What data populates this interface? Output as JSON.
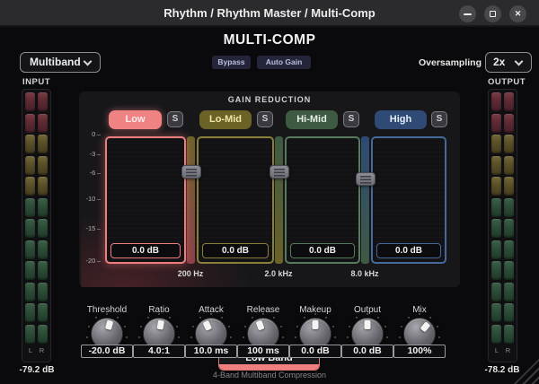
{
  "window": {
    "title": "Rhythm / Rhythm Master / Multi-Comp"
  },
  "header": {
    "title": "MULTI-COMP",
    "mode_value": "Multiband",
    "bypass_label": "Bypass",
    "auto_gain_label": "Auto Gain",
    "oversampling_label": "Oversampling",
    "oversampling_value": "2x"
  },
  "meters": {
    "input": {
      "label": "INPUT",
      "channels": [
        "L",
        "R"
      ],
      "value": "-79.2 dB",
      "segments": {
        "red": 2,
        "yellow": 3,
        "green": 7
      }
    },
    "output": {
      "label": "OUTPUT",
      "channels": [
        "L",
        "R"
      ],
      "value": "-78.2 dB",
      "segments": {
        "red": 2,
        "yellow": 3,
        "green": 7
      }
    },
    "segment_colors": {
      "red": "#5e2a33",
      "yellow": "#5a5028",
      "green": "#2c4d38"
    }
  },
  "gain_reduction": {
    "title": "GAIN REDUCTION",
    "solo_label": "S",
    "scale": [
      "0",
      "-3",
      "-6",
      "-10",
      "-15",
      "-20"
    ],
    "bands": [
      {
        "name": "Low",
        "value": "0.0 dB",
        "selected": true,
        "colors": {
          "tab_bg": "#ef8282",
          "tab_text": "#ffecec",
          "border": "#ee7e7e",
          "track": "#8a4048"
        }
      },
      {
        "name": "Lo-Mid",
        "value": "0.0 dB",
        "selected": false,
        "colors": {
          "tab_bg": "#6b6228",
          "tab_text": "#efe6a8",
          "border": "#8a7f3a",
          "track": "#6b6228"
        }
      },
      {
        "name": "Hi-Mid",
        "value": "0.0 dB",
        "selected": false,
        "colors": {
          "tab_bg": "#3e5a43",
          "tab_text": "#e6efe6",
          "border": "#57795c",
          "track": "#3e5a43"
        }
      },
      {
        "name": "High",
        "value": "0.0 dB",
        "selected": false,
        "colors": {
          "tab_bg": "#2e4a75",
          "tab_text": "#e6ecf8",
          "border": "#46699c",
          "track": "#2e4a75"
        }
      }
    ],
    "crossovers": [
      {
        "freq": "200 Hz"
      },
      {
        "freq": "2.0 kHz"
      },
      {
        "freq": "8.0 kHz"
      }
    ]
  },
  "knobs": [
    {
      "label": "Threshold",
      "value": "-20.0 dB",
      "angle": 15
    },
    {
      "label": "Ratio",
      "value": "4.0:1",
      "angle": 10
    },
    {
      "label": "Attack",
      "value": "10.0 ms",
      "angle": -25
    },
    {
      "label": "Release",
      "value": "100 ms",
      "angle": -20
    },
    {
      "label": "Makeup",
      "value": "0.0 dB",
      "angle": 0
    },
    {
      "label": "Output",
      "value": "0.0 dB",
      "angle": 0
    },
    {
      "label": "Mix",
      "value": "100%",
      "angle": 40
    }
  ],
  "band_indicator": {
    "label": "Low Band",
    "color": "#f08080"
  },
  "footer": {
    "caption": "4-Band Multiband Compression"
  }
}
